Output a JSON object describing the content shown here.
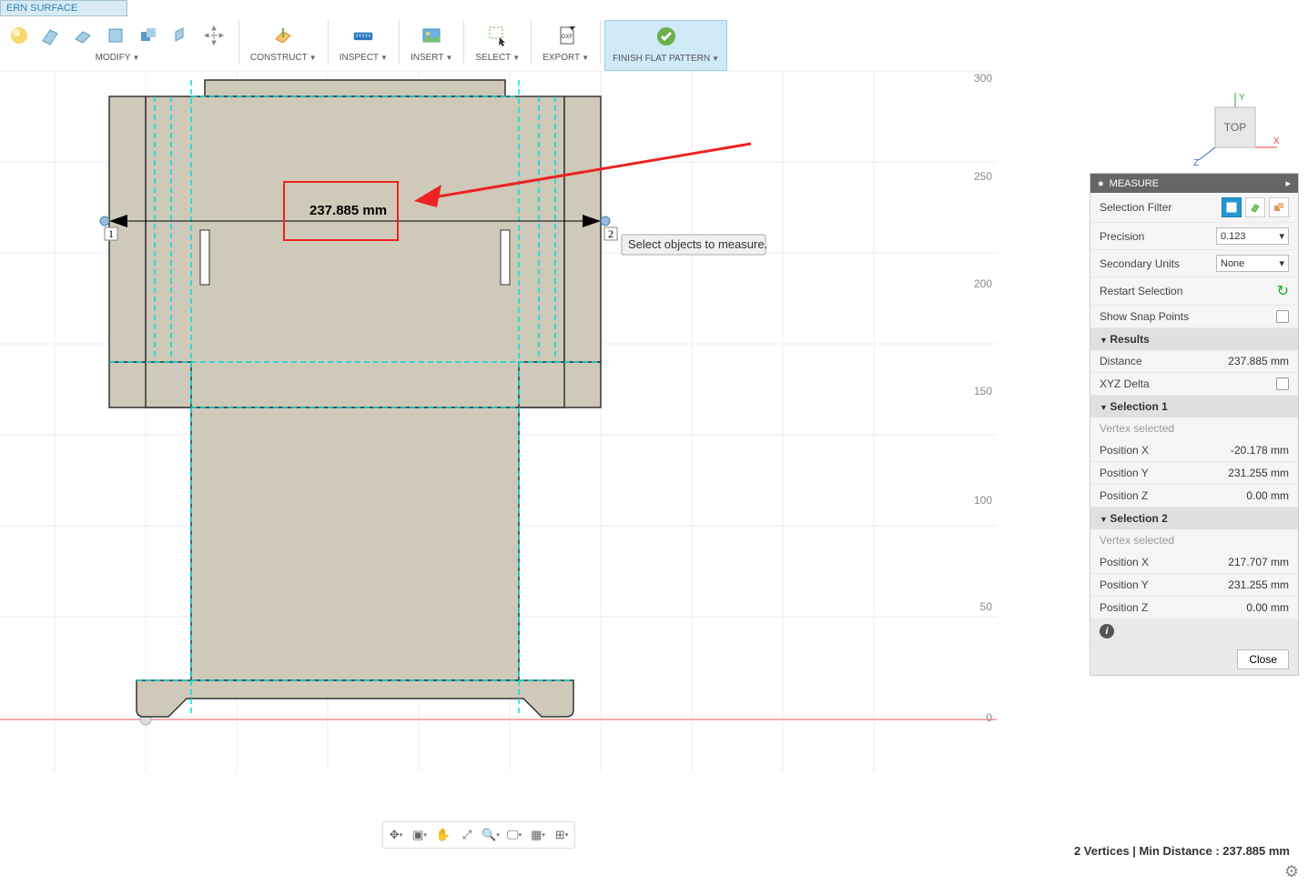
{
  "tab_title": "ERN SURFACE",
  "toolbar": {
    "modify": "MODIFY",
    "construct": "CONSTRUCT",
    "inspect": "INSPECT",
    "insert": "INSERT",
    "select": "SELECT",
    "export": "EXPORT",
    "finish": "FINISH FLAT PATTERN"
  },
  "canvas": {
    "dimension_value": "237.885 mm",
    "point1_label": "1",
    "point2_label": "2",
    "tooltip": "Select objects to measure.",
    "ruler_300": "300",
    "ruler_250": "250",
    "ruler_200": "200",
    "ruler_150": "150",
    "ruler_100": "100",
    "ruler_50": "50",
    "ruler_0": "0"
  },
  "viewcube": {
    "face": "TOP",
    "x": "X",
    "y": "Y",
    "z": "Z"
  },
  "measure_panel": {
    "title": "MEASURE",
    "selection_filter": "Selection Filter",
    "precision_lbl": "Precision",
    "precision_val": "0.123",
    "secondary_units_lbl": "Secondary Units",
    "secondary_units_val": "None",
    "restart": "Restart Selection",
    "snap": "Show Snap Points",
    "results": "Results",
    "distance_lbl": "Distance",
    "distance_val": "237.885 mm",
    "xyz_delta": "XYZ Delta",
    "selection1": "Selection 1",
    "vertex_selected": "Vertex selected",
    "posx_lbl": "Position X",
    "posy_lbl": "Position Y",
    "posz_lbl": "Position Z",
    "s1_x": "-20.178 mm",
    "s1_y": "231.255 mm",
    "s1_z": "0.00 mm",
    "selection2": "Selection 2",
    "s2_x": "217.707 mm",
    "s2_y": "231.255 mm",
    "s2_z": "0.00 mm",
    "close": "Close"
  },
  "status_bar": "2 Vertices | Min Distance : 237.885 mm"
}
